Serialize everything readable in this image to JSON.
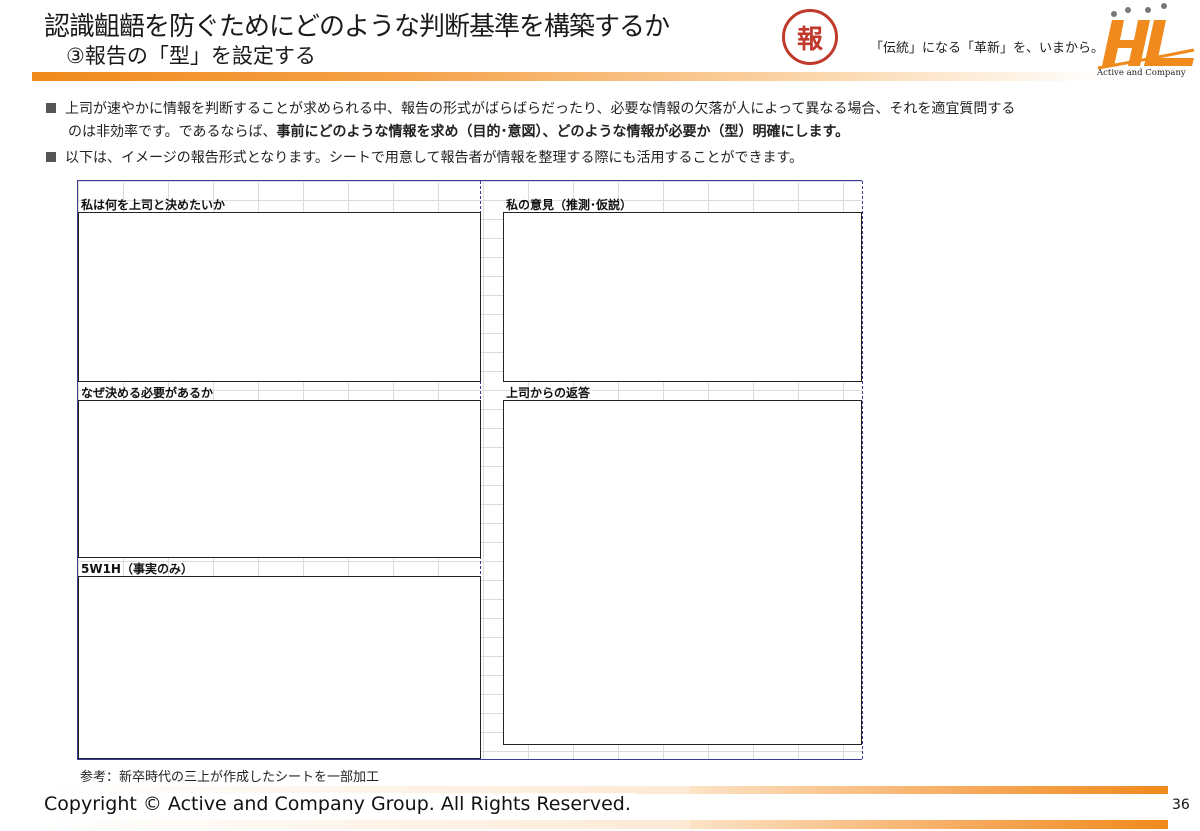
{
  "header": {
    "title": "認識齟齬を防ぐためにどのような判断基準を構築するか",
    "subtitle": "③報告の「型」を設定する",
    "badge": "報",
    "slogan": "「伝統」になる「革新」を、いまから。",
    "logo_text": "Active and Company",
    "accent_color": "#f08a1c"
  },
  "bullets": {
    "b1_line1": "上司が速やかに情報を判断することが求められる中、報告の形式がばらばらだったり、必要な情報の欠落が人によって異なる場合、それを適宜質問する",
    "b1_line2_plain": "のは非効率です。であるならば、",
    "b1_line2_bold": "事前にどのような情報を求め（目的･意図）、どのような情報が必要か（型）明確にします。",
    "b2": "以下は、イメージの報告形式となります。シートで用意して報告者が情報を整理する際にも活用することができます。"
  },
  "sheet": {
    "box1_label": "私は何を上司と決めたいか",
    "box2_label": "なぜ決める必要があるか",
    "box3_label": "5W1H（事実のみ）",
    "box4_label": "私の意見（推測･仮説）",
    "box5_label": "上司からの返答"
  },
  "footnote": "参考：新卒時代の三上が作成したシートを一部加工",
  "footer": {
    "copyright": "Copyright © Active and Company Group. All Rights Reserved.",
    "page_number": "36"
  }
}
